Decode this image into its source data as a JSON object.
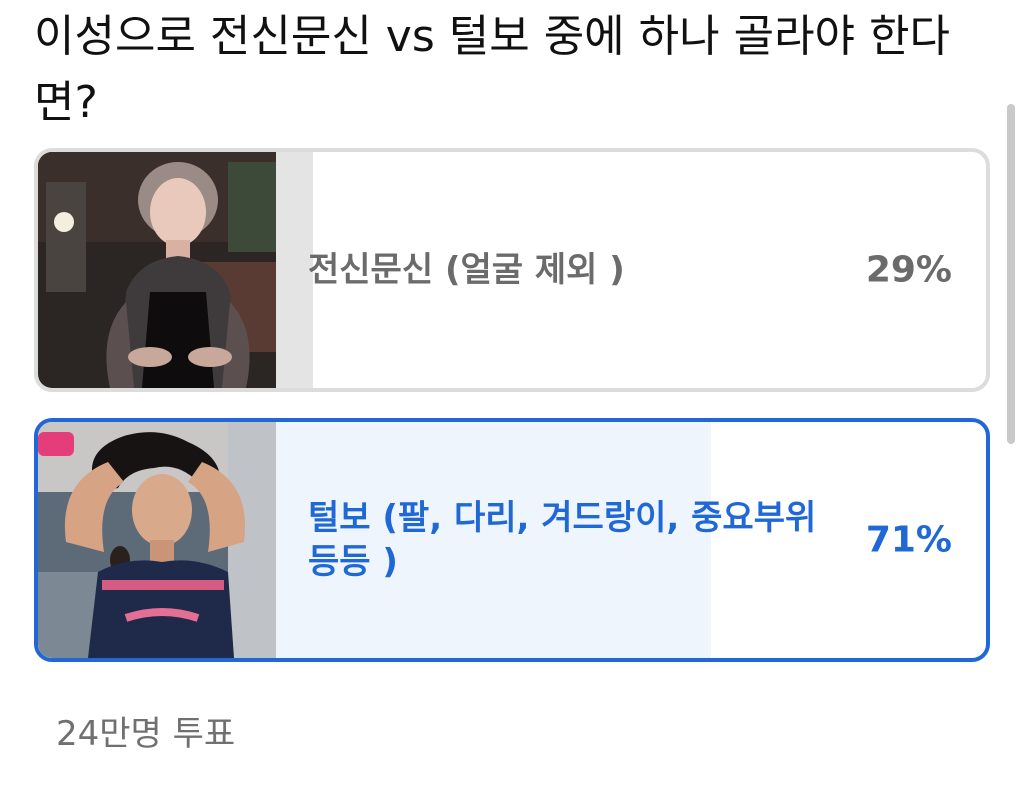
{
  "poll": {
    "question": "이성으로 전신문신 vs 털보 중에 하나 골라야 한다면?",
    "options": [
      {
        "label": "전신문신 (얼굴 제외 )",
        "percent_text": "29%",
        "percent": 29,
        "selected": false,
        "image": "photo-tattooed-woman"
      },
      {
        "label": "털보 (팔, 다리, 겨드랑이, 중요부위 등등 )",
        "percent_text": "71%",
        "percent": 71,
        "selected": true,
        "image": "photo-woman-arms-raised"
      }
    ],
    "vote_count_text": "24만명 투표"
  },
  "colors": {
    "accent": "#1f68d6",
    "unselected_border": "#dcdcdc",
    "unselected_fill": "#e4e4e4",
    "selected_fill": "#eef5fd",
    "muted_text": "#6b6b6b"
  }
}
